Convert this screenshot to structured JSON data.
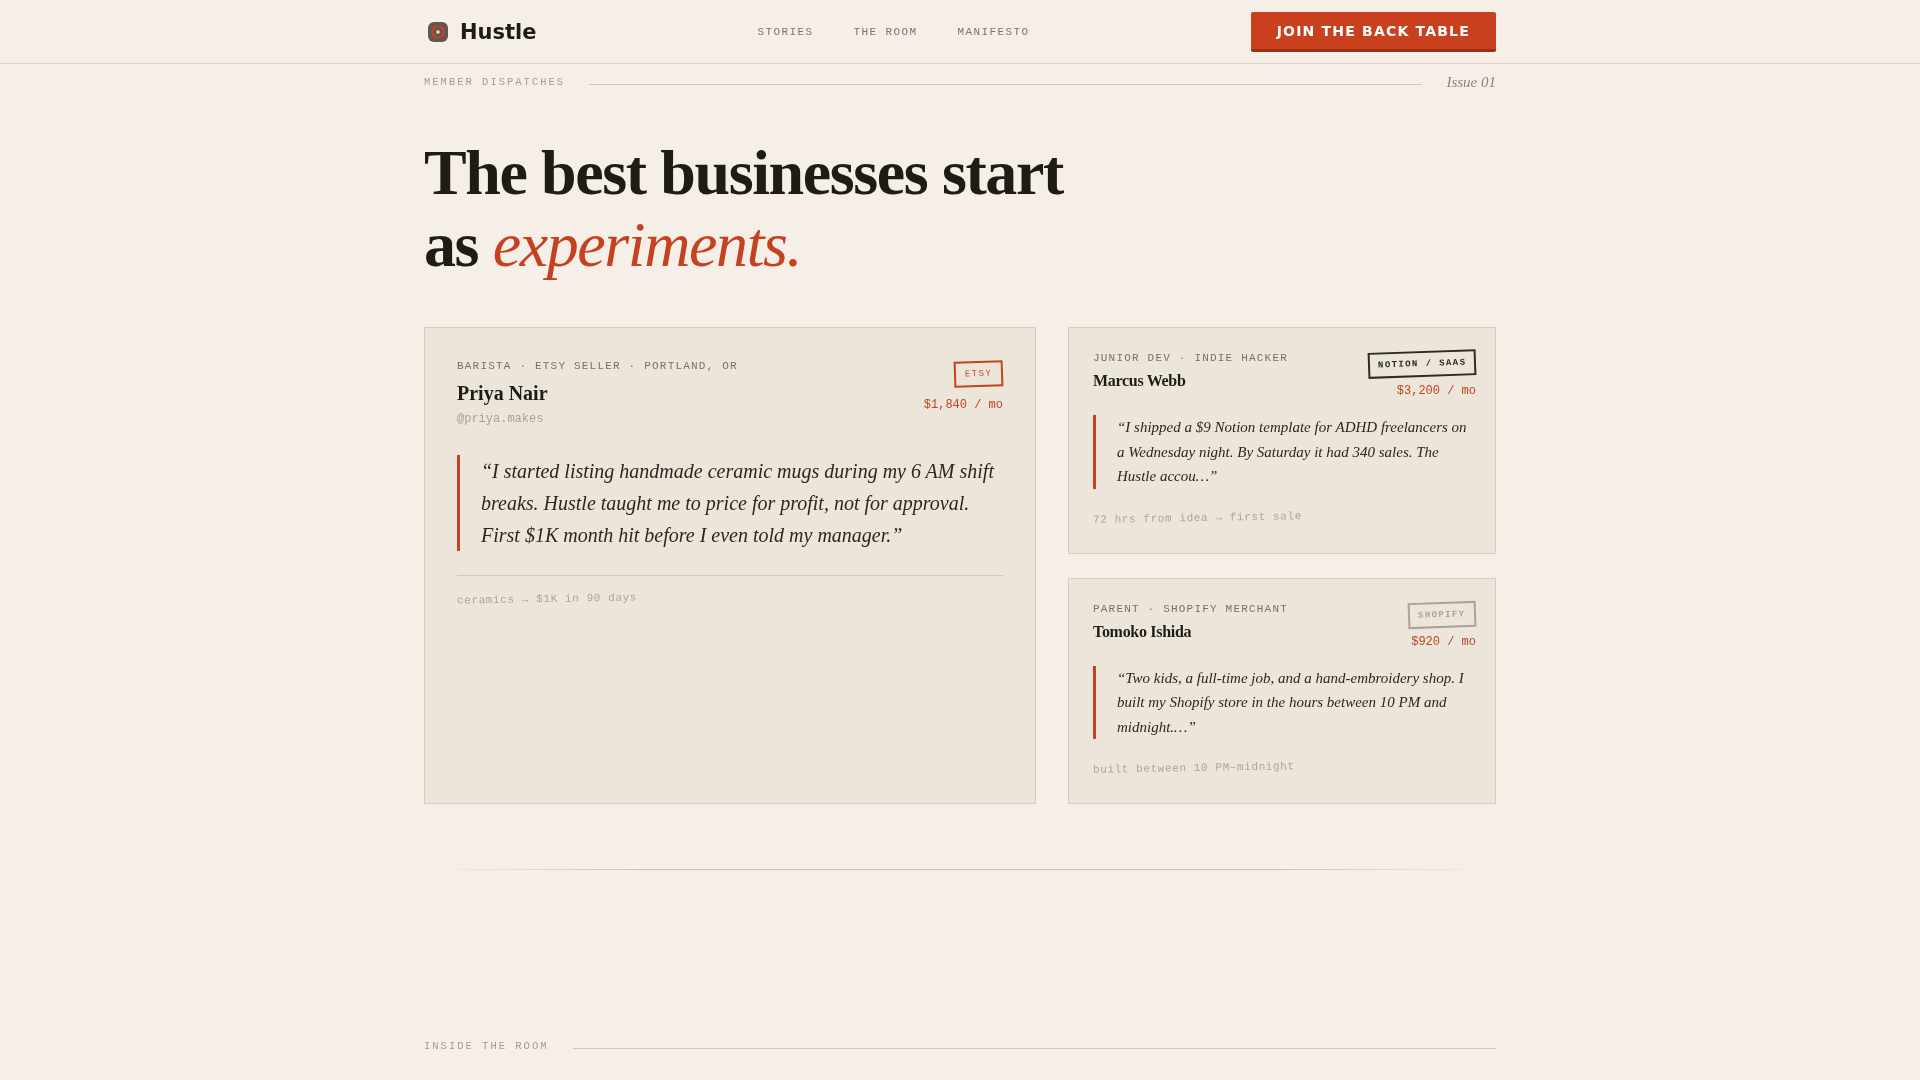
{
  "header": {
    "brand": "Hustle",
    "nav": [
      "STORIES",
      "THE ROOM",
      "MANIFESTO"
    ],
    "cta": "JOIN THE BACK TABLE"
  },
  "dispatch_bar": {
    "label": "MEMBER DISPATCHES",
    "issue": "Issue 01"
  },
  "headline": "The best businesses start as *experiments.*",
  "stories": [
    {
      "kind": "featured",
      "role": "BARISTA · ETSY SELLER · PORTLAND, OR",
      "name": "Priya Nair",
      "handle": "@priya.makes",
      "stamp": {
        "label": "ETSY",
        "color": "#c4421f"
      },
      "revenue": "$1,840 / mo",
      "quote": "“I started listing handmade ceramic mugs during my 6 AM shift breaks. Hustle taught me to price for profit, not for approval. First $1K month hit before I even told my manager.”",
      "footnote": "ceramics → $1K in 90 days"
    },
    {
      "kind": "compact",
      "role": "JUNIOR DEV · INDIE HACKER",
      "name": "Marcus Webb",
      "stamp": {
        "label": "NOTION / SAAS",
        "color": "#2e2a26"
      },
      "revenue": "$3,200 / mo",
      "quote": "“I shipped a $9 Notion template for ADHD freelancers on a Wednesday night. By Saturday it had 340 sales. The Hustle accou…”",
      "footnote": "72 hrs from idea → first sale"
    },
    {
      "kind": "compact",
      "role": "PARENT · SHOPIFY MERCHANT",
      "name": "Tomoko Ishida",
      "stamp": {
        "label": "SHOPIFY",
        "color": "#aaa39a"
      },
      "revenue": "$920 / mo",
      "quote": "“Two kids, a full-time job, and a hand-embroidery shop. I built my Shopify store in the hours between 10 PM and midnight.…”",
      "footnote": "built between 10 PM–midnight"
    }
  ],
  "next_section": {
    "label": "INSIDE THE ROOM"
  }
}
